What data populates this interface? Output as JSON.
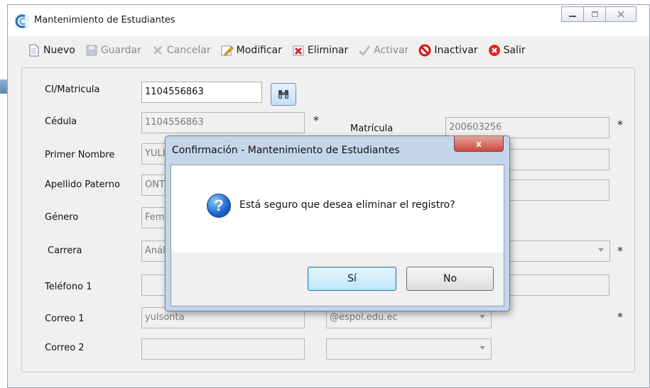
{
  "window": {
    "title": "Mantenimiento de Estudiantes"
  },
  "toolbar": {
    "nuevo": "Nuevo",
    "guardar": "Guardar",
    "cancelar": "Cancelar",
    "modificar": "Modificar",
    "eliminar": "Eliminar",
    "activar": "Activar",
    "inactivar": "Inactivar",
    "salir": "Salir"
  },
  "form": {
    "ci_label": "CI/Matricula",
    "ci_value": "1104556863",
    "cedula_label": "Cédula",
    "cedula_value": "1104556863",
    "matricula_label": "Matrícula",
    "matricula_value": "200603256",
    "primer_nombre_label": "Primer Nombre",
    "primer_nombre_value": "YULI",
    "apellido_paterno_label": "Apellido Paterno",
    "apellido_paterno_value": "ONT",
    "genero_label": "Género",
    "genero_value": "Fem",
    "carrera_label": "Carrera",
    "carrera_value": "Anál",
    "telefono1_label": "Teléfono 1",
    "correo1_label": "Correo 1",
    "correo1_user": "yulsonta",
    "correo1_domain": "@espol.edu.ec",
    "correo2_label": "Correo 2",
    "required_mark": "*"
  },
  "dialog": {
    "title": "Confirmación - Mantenimiento de Estudiantes",
    "close_glyph": "x",
    "message": "Está seguro que desea eliminar el registro?",
    "yes_label": "Sí",
    "no_label": "No"
  },
  "colors": {
    "accent": "#3c7fb1",
    "dialog_frame": "#c6d6ea",
    "close_red": "#c9483c"
  },
  "icons": [
    "app-icon",
    "document-icon",
    "save-icon",
    "cancel-x-icon",
    "edit-icon",
    "delete-icon",
    "check-icon",
    "ban-icon",
    "exit-icon",
    "binoculars-icon",
    "question-icon"
  ]
}
